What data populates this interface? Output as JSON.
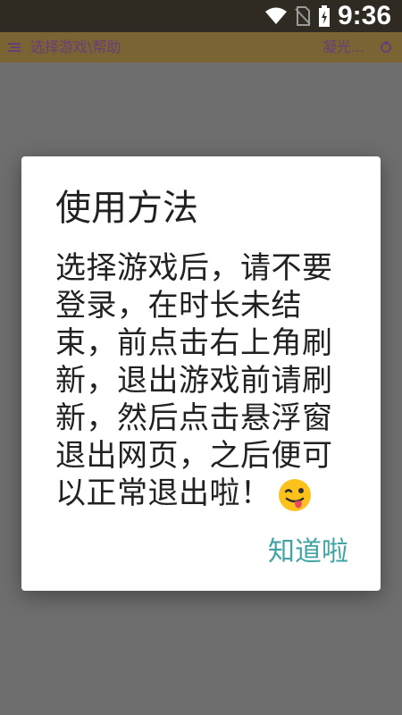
{
  "status_bar": {
    "time": "9:36",
    "icons": [
      "wifi-icon",
      "no-sim-icon",
      "battery-charging-icon"
    ]
  },
  "app_bar": {
    "title": "选择游戏\\帮助",
    "right_text": "凝光..."
  },
  "dialog": {
    "title": "使用方法",
    "message": "选择游戏后，请不要登录，在时长未结束，前点击右上角刷新，退出游戏前请刷新，然后点击悬浮窗退出网页，之后便可以正常退出啦！",
    "emoji": "winking-tongue-face",
    "confirm_label": "知道啦"
  },
  "colors": {
    "status_bar_bg": "#2f2a22",
    "scrim": "#6e6e6e",
    "dialog_bg": "#ffffff",
    "button_text": "#41a3a3"
  }
}
